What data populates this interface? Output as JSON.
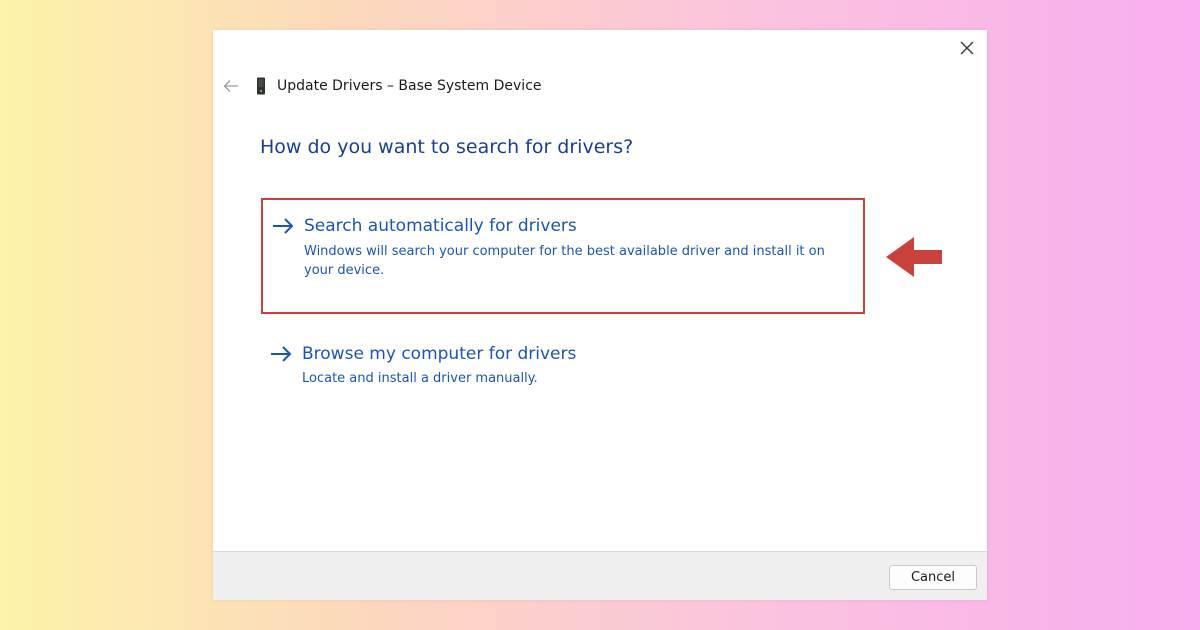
{
  "dialog": {
    "title": "Update Drivers – Base System Device",
    "heading": "How do you want to search for drivers?",
    "options": [
      {
        "title": "Search automatically for drivers",
        "description": "Windows will search your computer for the best available driver and install it on your device."
      },
      {
        "title": "Browse my computer for drivers",
        "description": "Locate and install a driver manually."
      }
    ],
    "cancel_label": "Cancel",
    "icons": {
      "close": "close-icon",
      "back": "back-arrow-icon",
      "device": "device-icon",
      "option": "arrow-right-icon"
    }
  },
  "annotation": {
    "pointer": "left-arrow-pointer",
    "highlight_color": "#c9413b"
  },
  "colors": {
    "link_blue": "#1a56b0",
    "heading_blue": "#1a3f8f",
    "footer_bg": "#f0f0f0"
  }
}
